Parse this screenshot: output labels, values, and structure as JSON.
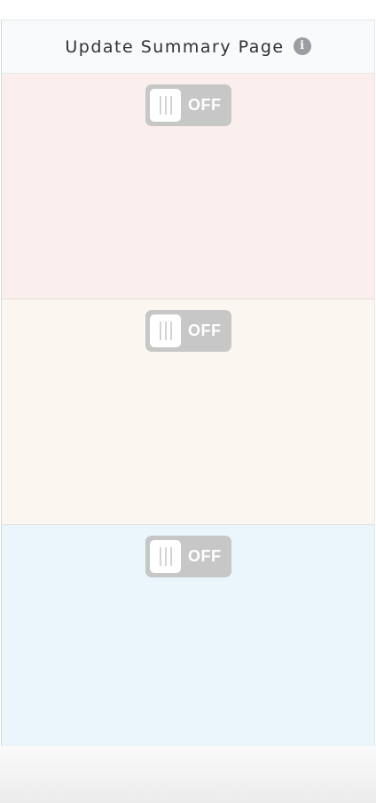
{
  "column": {
    "title": "Update Summary Page",
    "info_icon": "info-icon"
  },
  "rows": [
    {
      "background": "#fbefed",
      "toggle": {
        "state": "off",
        "label": "OFF"
      }
    },
    {
      "background": "#fbf6ef",
      "toggle": {
        "state": "off",
        "label": "OFF"
      }
    },
    {
      "background": "#eaf5fc",
      "toggle": {
        "state": "off",
        "label": "OFF"
      }
    }
  ],
  "colors": {
    "toggle_off": "#c7c7c7",
    "header_bg": "#f8fafb",
    "title_text": "#2f3337",
    "info_icon": "#9a9da1"
  }
}
